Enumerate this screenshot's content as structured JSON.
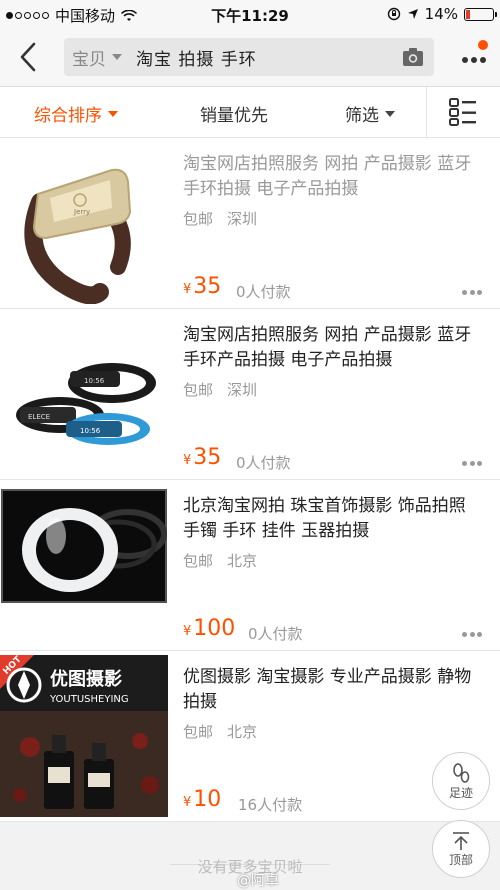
{
  "status_bar": {
    "carrier": "中国移动",
    "time": "下午11:29",
    "battery": "14%"
  },
  "search": {
    "scope": "宝贝",
    "query": "淘宝 拍摄 手环"
  },
  "sort": {
    "comprehensive": "综合排序",
    "sales": "销量优先",
    "filter": "筛选"
  },
  "items": [
    {
      "title": "淘宝网店拍照服务 网拍 产品摄影 蓝牙手环拍摄 电子产品拍摄",
      "shipping": "包邮",
      "location": "深圳",
      "currency": "¥",
      "price": "35",
      "sold": "0人付款"
    },
    {
      "title": "淘宝网店拍照服务 网拍 产品摄影 蓝牙手环产品拍摄 电子产品拍摄",
      "shipping": "包邮",
      "location": "深圳",
      "currency": "¥",
      "price": "35",
      "sold": "0人付款"
    },
    {
      "title": "北京淘宝网拍 珠宝首饰摄影 饰品拍照 手镯 手环 挂件 玉器拍摄",
      "shipping": "包邮",
      "location": "北京",
      "currency": "¥",
      "price": "100",
      "sold": "0人付款"
    },
    {
      "title": "优图摄影 淘宝摄影 专业产品摄影 静物拍摄",
      "shipping": "包邮",
      "location": "北京",
      "currency": "¥",
      "price": "10",
      "sold": "16人付款"
    }
  ],
  "thumb_texts": {
    "hot": "HOT",
    "brand_cn": "优图摄影",
    "brand_en": "YOUTUSHEYING",
    "band1": "Jerry",
    "band2a": "ELECE",
    "band2b": "10:56",
    "band2c": "10:56"
  },
  "footer": {
    "end_text": "没有更多宝贝啦",
    "watermark": "@阿卓"
  },
  "fab": {
    "footprint": "足迹",
    "top": "顶部"
  },
  "colors": {
    "accent": "#ff5000"
  }
}
